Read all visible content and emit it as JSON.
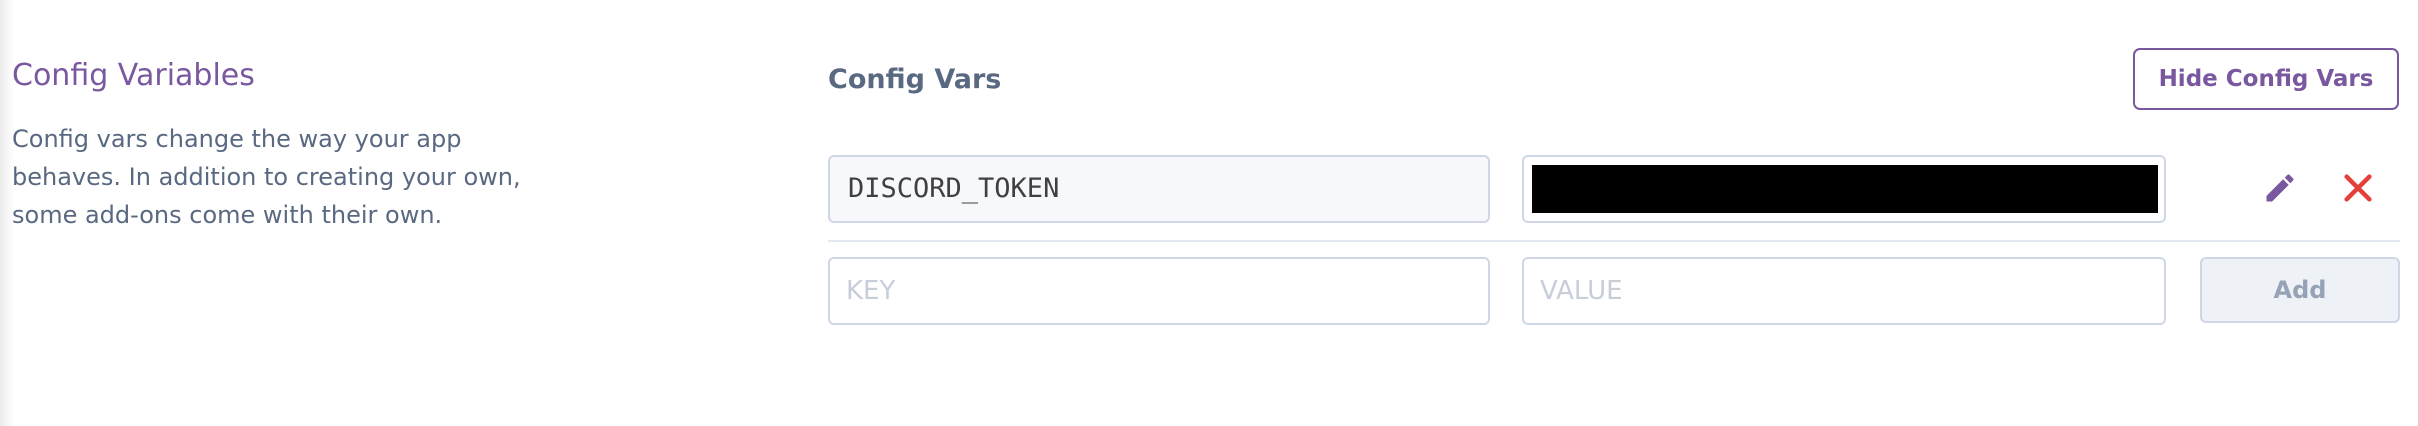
{
  "section": {
    "title": "Config Variables",
    "description": "Config vars change the way your app behaves. In addition to creating your own, some add-ons come with their own."
  },
  "config_vars": {
    "heading": "Config Vars",
    "hide_button_label": "Hide Config Vars",
    "entries": [
      {
        "key": "DISCORD_TOKEN",
        "value_redacted": true
      }
    ],
    "new_entry": {
      "key_placeholder": "KEY",
      "value_placeholder": "VALUE",
      "add_button_label": "Add"
    }
  },
  "icons": {
    "edit": "pencil-icon",
    "delete": "close-icon"
  },
  "colors": {
    "accent_purple": "#79589f",
    "delete_red": "#e3403c",
    "text_slate": "#596981",
    "border": "#cfd7e6"
  }
}
